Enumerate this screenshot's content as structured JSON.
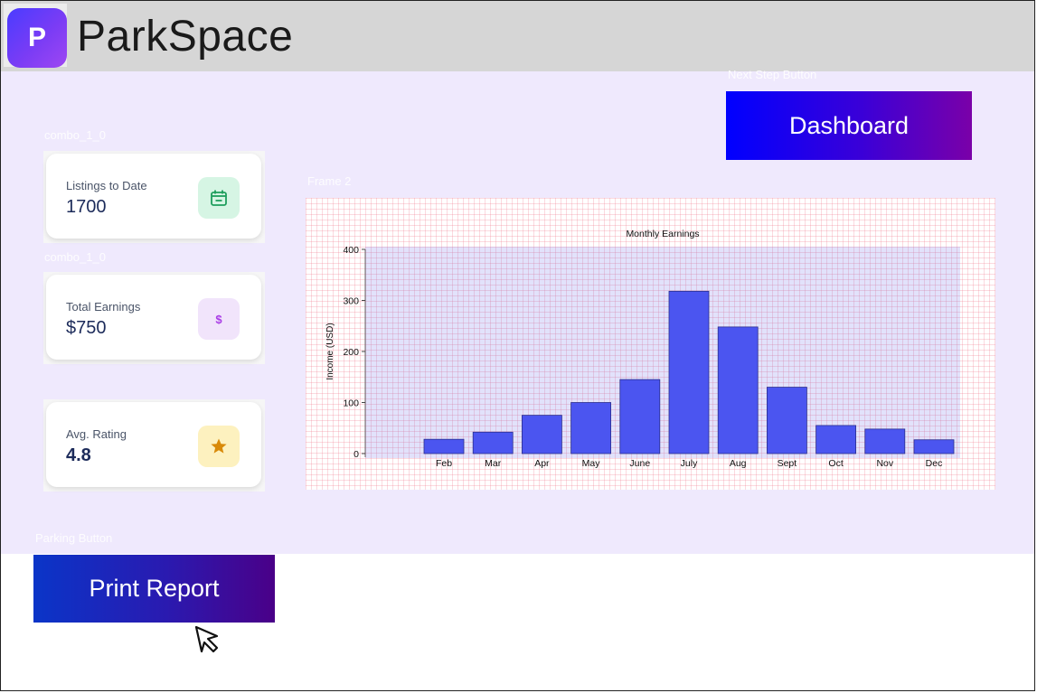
{
  "app": {
    "logo_letter": "P",
    "brand": "ParkSpace"
  },
  "labels": {
    "next_step": "Next Step Button",
    "combo_a": "combo_1_0",
    "combo_b": "combo_1_0",
    "frame": "Frame 2",
    "parking": "Parking Button"
  },
  "buttons": {
    "dashboard": "Dashboard",
    "print": "Print Report"
  },
  "stats": [
    {
      "label": "Listings to Date",
      "value": "1700",
      "icon": "calendar-icon",
      "icon_bg": "#d6f5e4",
      "icon_color": "#1e9e5c"
    },
    {
      "label": "Total Earnings",
      "value": "$750",
      "icon": "dollar-icon",
      "icon_bg": "#f1e4fb",
      "icon_color": "#a93ce6"
    },
    {
      "label": "Avg. Rating",
      "value": "4.8",
      "icon": "star-icon",
      "icon_bg": "#fdf1bf",
      "icon_color": "#d98a09"
    }
  ],
  "chart_data": {
    "type": "bar",
    "title": "Monthly Earnings",
    "xlabel": "",
    "ylabel": "Income (USD)",
    "categories": [
      "Feb",
      "Mar",
      "Apr",
      "May",
      "June",
      "July",
      "Aug",
      "Sept",
      "Oct",
      "Nov",
      "Dec"
    ],
    "values": [
      28,
      42,
      75,
      100,
      145,
      318,
      248,
      130,
      55,
      48,
      27
    ],
    "ylim": [
      0,
      400
    ],
    "yticks": [
      0,
      100,
      200,
      300,
      400
    ],
    "grid": false,
    "bar_color": "#4b55f0"
  }
}
